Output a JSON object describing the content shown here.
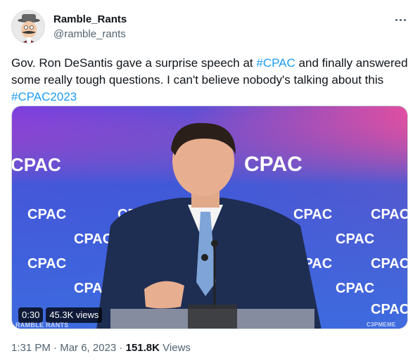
{
  "author": {
    "name": "Ramble_Rants",
    "handle": "@ramble_rants"
  },
  "tweet": {
    "text_before": "Gov. Ron DeSantis gave a surprise speech at ",
    "hashtag1": "#CPAC",
    "text_middle": " and finally answered some really tough questions. I can't believe nobody's talking about this ",
    "hashtag2": "#CPAC2023"
  },
  "media": {
    "duration": "0:30",
    "views": "45.3K views",
    "watermark_left": "RAMBLE RANTS",
    "watermark_right": "C3PMEME",
    "backdrop_logo": "CPAC"
  },
  "meta": {
    "time": "1:31 PM",
    "separator": "·",
    "date": "Mar 6, 2023",
    "views_count": "151.8K",
    "views_label": "Views"
  },
  "icons": {
    "more": "more-horizontal-icon"
  },
  "colors": {
    "link": "#1d9bf0",
    "secondary_text": "#536471"
  }
}
